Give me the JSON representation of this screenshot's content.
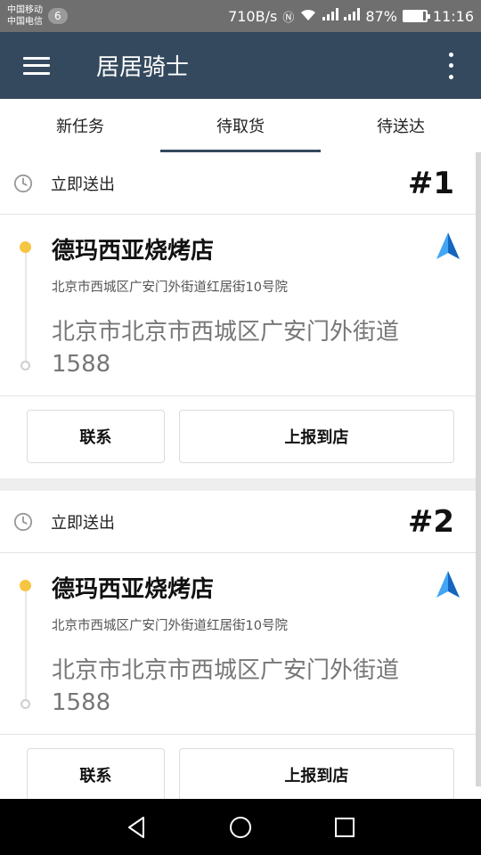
{
  "status_bar": {
    "carrier1": "中国移动",
    "carrier2": "中国电信",
    "notification_count": "6",
    "net_speed": "710B/s",
    "battery": "87%",
    "time": "11:16"
  },
  "app_bar": {
    "title": "居居骑士"
  },
  "tabs": [
    {
      "label": "新任务",
      "active": false
    },
    {
      "label": "待取货",
      "active": true
    },
    {
      "label": "待送达",
      "active": false
    }
  ],
  "orders": [
    {
      "deliver_text": "立即送出",
      "order_no": "#1",
      "shop_name": "德玛西亚烧烤店",
      "shop_address": "北京市西城区广安门外街道红居街10号院",
      "destination": "北京市北京市西城区广安门外街道1588",
      "contact_label": "联系",
      "report_label": "上报到店"
    },
    {
      "deliver_text": "立即送出",
      "order_no": "#2",
      "shop_name": "德玛西亚烧烤店",
      "shop_address": "北京市西城区广安门外街道红居街10号院",
      "destination": "北京市北京市西城区广安门外街道1588",
      "contact_label": "联系",
      "report_label": "上报到店"
    }
  ],
  "colors": {
    "app_bar": "#34495e",
    "pickup_dot": "#f6c542",
    "nav_arrow": "#1e88e5"
  },
  "icons": [
    "menu-icon",
    "more-icon",
    "clock-icon",
    "navigation-arrow-icon",
    "back-icon",
    "home-icon",
    "recents-icon"
  ]
}
